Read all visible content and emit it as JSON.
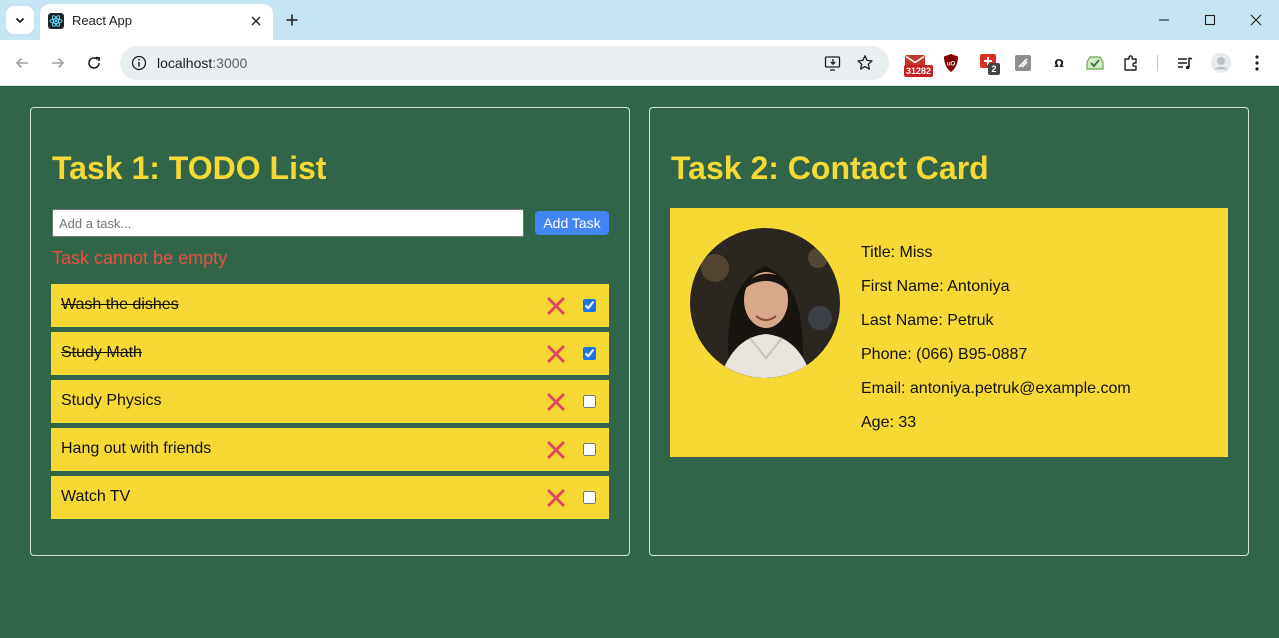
{
  "browser": {
    "tab_title": "React App",
    "url_host": "localhost",
    "url_port": ":3000",
    "extensions": {
      "gmail_badge": "31282",
      "counter_badge": "2"
    }
  },
  "todo": {
    "title": "Task 1: TODO List",
    "input": {
      "placeholder": "Add a task...",
      "value": ""
    },
    "add_label": "Add Task",
    "error": "Task cannot be empty",
    "items": [
      {
        "text": "Wash the dishes",
        "done": true
      },
      {
        "text": "Study Math",
        "done": true
      },
      {
        "text": "Study Physics",
        "done": false
      },
      {
        "text": "Hang out with friends",
        "done": false
      },
      {
        "text": "Watch TV",
        "done": false
      }
    ]
  },
  "contact": {
    "title": "Task 2: Contact Card",
    "lines": [
      "Title: Miss",
      "First Name: Antoniya",
      "Last Name: Petruk",
      "Phone: (066) B95-0887",
      "Email: antoniya.petruk@example.com",
      "Age: 33"
    ]
  },
  "colors": {
    "page_bg": "#30654a",
    "accent_yellow": "#f6d935",
    "error_red": "#e8503f",
    "button_blue": "#4285f4",
    "delete_red": "#e0455e"
  }
}
